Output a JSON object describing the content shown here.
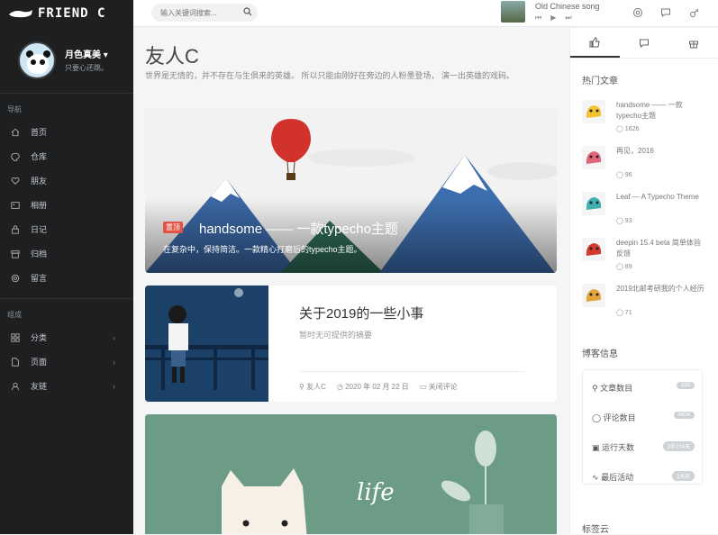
{
  "logo": {
    "text": "FRIEND C"
  },
  "profile": {
    "name": "月色真美",
    "caret": "▾",
    "desc": "只要心还跳。"
  },
  "sidebar": {
    "section_nav": "导航",
    "nav": [
      {
        "label": "首页",
        "icon": "home-icon"
      },
      {
        "label": "仓库",
        "icon": "github-icon"
      },
      {
        "label": "朋友",
        "icon": "heart-icon"
      },
      {
        "label": "相册",
        "icon": "image-icon"
      },
      {
        "label": "日记",
        "icon": "lock-icon"
      },
      {
        "label": "归档",
        "icon": "archive-icon"
      },
      {
        "label": "留言",
        "icon": "at-icon"
      }
    ],
    "section_group": "组成",
    "group": [
      {
        "label": "分类",
        "icon": "grid-icon"
      },
      {
        "label": "页面",
        "icon": "file-icon"
      },
      {
        "label": "友链",
        "icon": "user-icon"
      }
    ]
  },
  "topbar": {
    "search_placeholder": "输入关键词搜索...",
    "song": "Old Chinese song",
    "ctrl_prev": "⏮",
    "ctrl_play": "▶",
    "ctrl_next": "⏭"
  },
  "main": {
    "title": "友人C",
    "subtitle": "世界是无情的，并不存在与生俱来的英雄。 所以只能由刚好在旁边的人粉墨登场， 演一出英雄的戏码。",
    "hero": {
      "badge": "置顶",
      "title": "handsome —— 一款typecho主题",
      "desc": "在复杂中，保持简洁。一款精心打磨后的typecho主题。"
    },
    "post": {
      "title": "关于2019的一些小事",
      "desc": "暂时无可提供的摘要",
      "author": "友人C",
      "date": "2020 年 02 月 22 日",
      "comments": "关闭评论"
    },
    "card3": {
      "text": "life"
    }
  },
  "right": {
    "hot_title": "热门文章",
    "hot": [
      {
        "title": "handsome —— 一款typecho主题",
        "count": "1626",
        "color": "#f2c230"
      },
      {
        "title": "再见，2016",
        "count": "96",
        "color": "#e0677a"
      },
      {
        "title": "Leaf — A Typecho Theme",
        "count": "93",
        "color": "#3fb2b0"
      },
      {
        "title": "deepin 15.4 beta 简单体验反馈",
        "count": "89",
        "color": "#d33a2f"
      },
      {
        "title": "2019北邮考研我的个人经历",
        "count": "71",
        "color": "#e5a53b"
      }
    ],
    "info_title": "博客信息",
    "stats": [
      {
        "label": "文章数目",
        "value": "233"
      },
      {
        "label": "评论数目",
        "value": "6604"
      },
      {
        "label": "运行天数",
        "value": "3年274天"
      },
      {
        "label": "最后活动",
        "value": "1天前"
      }
    ],
    "tags_title": "标签云"
  }
}
